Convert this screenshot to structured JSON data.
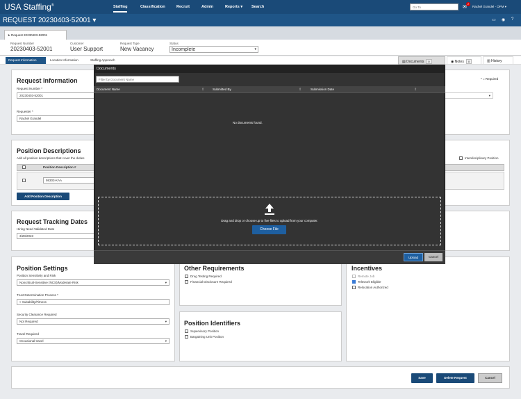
{
  "topnav": {
    "logo": "USA Staffing",
    "logo_mark": "®",
    "items": [
      "Staffing",
      "Classification",
      "Recruit",
      "Admin",
      "Reports",
      "Search"
    ],
    "reports_caret": "▾",
    "goto_placeholder": "Go To",
    "mail_count": "2",
    "user": "Rachel Grandel - OPM ▾"
  },
  "header": {
    "title": "REQUEST 20230403-52001 ▾"
  },
  "doc_tab": "Request 20230403-52001",
  "info": {
    "request_number_label": "Request Number",
    "request_number": "20230403-52001",
    "customer_label": "Customer",
    "customer": "User Support",
    "request_type_label": "Request Type",
    "request_type": "New Vacancy",
    "status_label": "Status",
    "status": "Incomplete"
  },
  "crumbs": [
    "Request Information",
    "Location Information",
    "Staffing Approach"
  ],
  "right_tabs": {
    "documents": "Documents",
    "documents_count": "0",
    "notes": "Notes",
    "notes_count": "0",
    "history": "History"
  },
  "request_info": {
    "title": "Request Information",
    "required_note": "* = Required",
    "req_number_label": "Request Number *",
    "req_number": "20230403-52001",
    "requester_label": "Requester *",
    "requester": "Rachel Grandel"
  },
  "position_desc": {
    "title": "Position Descriptions",
    "subtitle": "Add all position descriptions that cover the duties",
    "interdisciplinary": "Interdisciplinary Position",
    "col_pd": "Position Description #",
    "row_value": "98303-KAA",
    "add_button": "Add Position Description"
  },
  "tracking": {
    "title": "Request Tracking Dates",
    "hiring_label": "Hiring Need Validated Date",
    "hiring_value": "3/28/2023"
  },
  "position_settings": {
    "title": "Position Settings",
    "sensitivity_label": "Position Sensitivity and Risk",
    "sensitivity": "Noncritical-Sensitive (NCS)/Moderate Risk",
    "trust_label": "Trust Determination Process *",
    "trust": "× Suitability/Fitness",
    "clearance_label": "Security Clearance Required",
    "clearance": "Not Required",
    "travel_label": "Travel Required",
    "travel": "Occasional travel"
  },
  "other_req": {
    "title": "Other Requirements",
    "drug": "Drug Testing Required",
    "financial": "Financial Disclosure Required"
  },
  "identifiers": {
    "title": "Position Identifiers",
    "supervisory": "Supervisory Position",
    "bargaining": "Bargaining Unit Position"
  },
  "incentives": {
    "title": "Incentives",
    "remote": "Remote Job",
    "telework": "Telework Eligible",
    "relocation": "Relocation Authorized"
  },
  "modal": {
    "title": "Documents",
    "filter_placeholder": "Filter by Document Name",
    "col_name": "Document Name",
    "col_submitted_by": "Submitted By",
    "col_date": "Submission Date",
    "empty": "No documents found.",
    "drop_text": "Drag and drop or choose up to five files to upload from your computer.",
    "choose_file": "Choose File",
    "upload": "Upload",
    "cancel": "Cancel"
  },
  "footer": {
    "save": "Save",
    "delete": "Delete Request",
    "cancel": "Cancel"
  }
}
